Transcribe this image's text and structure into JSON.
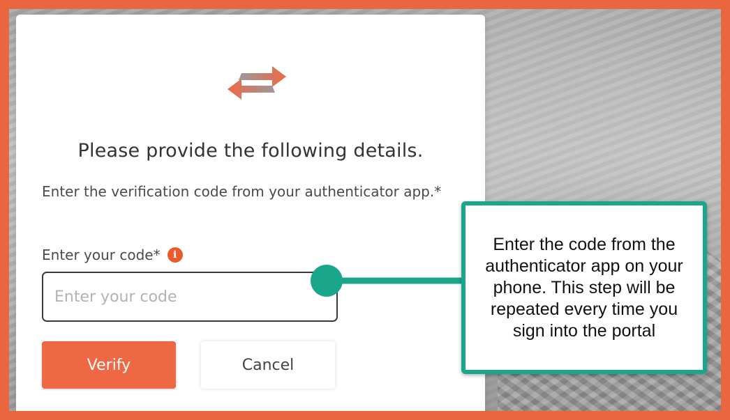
{
  "colors": {
    "accent": "#ef6844",
    "callout_border": "#1aa68a",
    "frame": "#e9663f"
  },
  "logo": {
    "icon": "exchange-arrows-icon"
  },
  "form": {
    "heading": "Please provide the following details.",
    "instruction": "Enter the verification code from your authenticator app.*",
    "code_label": "Enter your code*",
    "code_placeholder": "Enter your code",
    "code_value": "",
    "info_icon": "info-icon",
    "verify_label": "Verify",
    "cancel_label": "Cancel"
  },
  "callout": {
    "text": "Enter the code from the authenticator app on your phone. This step will be repeated every time you sign into the portal"
  }
}
